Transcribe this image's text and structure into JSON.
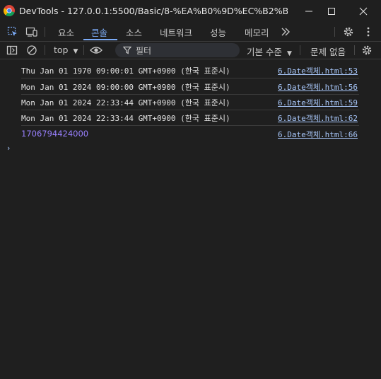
{
  "window": {
    "title": "DevTools - 127.0.0.1:5500/Basic/8-%EA%B0%9D%EC%B2%B4/6.Dat..."
  },
  "tabs": [
    {
      "label": "요소"
    },
    {
      "label": "콘솔"
    },
    {
      "label": "소스"
    },
    {
      "label": "네트워크"
    },
    {
      "label": "성능"
    },
    {
      "label": "메모리"
    }
  ],
  "active_tab": "콘솔",
  "toolbar": {
    "context": "top",
    "filter_placeholder": "필터",
    "levels": "기본 수준",
    "issues": "문제 없음"
  },
  "console": {
    "messages": [
      {
        "text": "Thu Jan 01 1970 09:00:01 GMT+0900 (한국 표준시)",
        "source": "6.Date객체.html:53"
      },
      {
        "text": "Mon Jan 01 2024 09:00:00 GMT+0900 (한국 표준시)",
        "source": "6.Date객체.html:56"
      },
      {
        "text": "Mon Jan 01 2024 22:33:44 GMT+0900 (한국 표준시)",
        "source": "6.Date객체.html:59"
      },
      {
        "text": "Mon Jan 01 2024 22:33:44 GMT+0900 (한국 표준시)",
        "source": "6.Date객체.html:62"
      },
      {
        "text": "1706794424000",
        "source": "6.Date객체.html:66"
      }
    ],
    "prompt_symbol": "›"
  },
  "colors": {
    "background": "#1f1f1f",
    "accent": "#7cacf8",
    "link": "#a8c7fa",
    "number": "#9980ff"
  }
}
